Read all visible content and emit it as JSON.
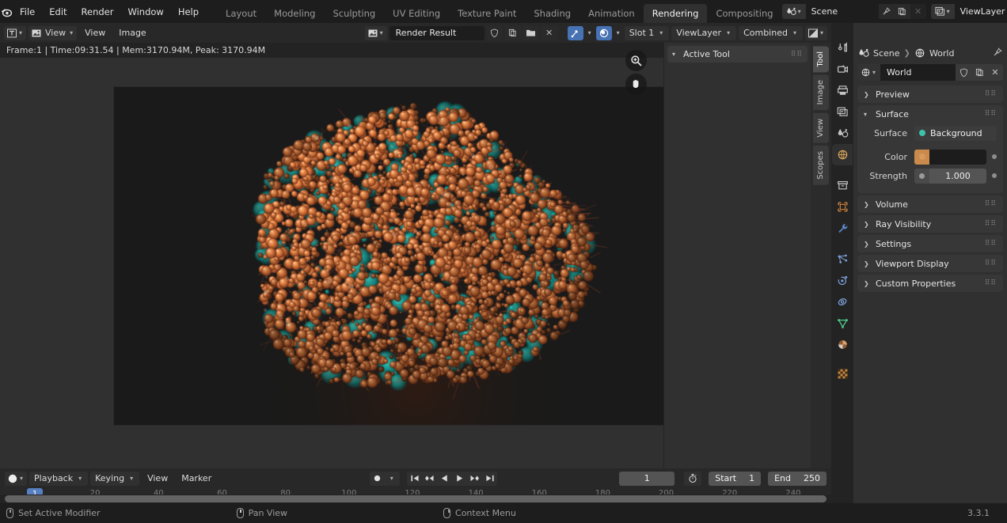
{
  "app": {
    "name": "Blender",
    "version": "3.3.1"
  },
  "topbar": {
    "menus": [
      "File",
      "Edit",
      "Render",
      "Window",
      "Help"
    ],
    "workspaces": [
      {
        "label": "Layout",
        "active": false
      },
      {
        "label": "Modeling",
        "active": false
      },
      {
        "label": "Sculpting",
        "active": false
      },
      {
        "label": "UV Editing",
        "active": false
      },
      {
        "label": "Texture Paint",
        "active": false
      },
      {
        "label": "Shading",
        "active": false
      },
      {
        "label": "Animation",
        "active": false
      },
      {
        "label": "Rendering",
        "active": true
      },
      {
        "label": "Compositing",
        "active": false
      }
    ],
    "scene": {
      "name": "Scene",
      "icon": "scene-icon"
    },
    "viewlayer": {
      "name": "ViewLayer",
      "icon": "viewlayer-icon"
    }
  },
  "image_editor": {
    "editor_type_icon": "image-editor-icon",
    "display_mode": "View",
    "menus": [
      "View",
      "Image"
    ],
    "image_datablock": "Render Result",
    "slot": "Slot 1",
    "view_layer": "ViewLayer",
    "pass": "Combined",
    "render_info": "Frame:1 | Time:09:31.54 | Mem:3170.94M, Peak: 3170.94M",
    "gizmos": [
      "zoom-icon",
      "pan-icon"
    ]
  },
  "sidebar": {
    "panels": [
      {
        "label": "Active Tool",
        "open": true
      }
    ],
    "tabs": [
      {
        "label": "Tool",
        "active": true
      },
      {
        "label": "Image",
        "active": false
      },
      {
        "label": "View",
        "active": false
      },
      {
        "label": "Scopes",
        "active": false
      }
    ]
  },
  "properties": {
    "breadcrumb": {
      "scene": "Scene",
      "datablock": "World"
    },
    "id_name": "World",
    "tabs": [
      {
        "name": "tool",
        "active": false
      },
      {
        "name": "render",
        "active": false
      },
      {
        "name": "output",
        "active": false
      },
      {
        "name": "view-layer",
        "active": false
      },
      {
        "name": "scene",
        "active": false
      },
      {
        "name": "world",
        "active": true
      },
      {
        "name": "collection",
        "active": false
      },
      {
        "name": "object",
        "active": false
      },
      {
        "name": "modifier",
        "active": false
      },
      {
        "name": "particles",
        "active": false
      },
      {
        "name": "physics",
        "active": false
      },
      {
        "name": "constraints",
        "active": false
      },
      {
        "name": "data",
        "active": false
      },
      {
        "name": "material",
        "active": false
      },
      {
        "name": "texture",
        "active": false
      }
    ],
    "panels": [
      {
        "label": "Preview",
        "open": false
      },
      {
        "label": "Surface",
        "open": true
      },
      {
        "label": "Volume",
        "open": false
      },
      {
        "label": "Ray Visibility",
        "open": false
      },
      {
        "label": "Settings",
        "open": false
      },
      {
        "label": "Viewport Display",
        "open": false
      },
      {
        "label": "Custom Properties",
        "open": false
      }
    ],
    "surface": {
      "surface_label": "Surface",
      "surface_value": "Background",
      "color_label": "Color",
      "color_value": "#1c1c1c",
      "strength_label": "Strength",
      "strength_value": "1.000"
    }
  },
  "timeline": {
    "editor_icon": "timeline-icon",
    "menus": [
      "Playback",
      "Keying",
      "View",
      "Marker"
    ],
    "current_frame": "1",
    "start_label": "Start",
    "start_value": "1",
    "end_label": "End",
    "end_value": "250",
    "ruler_ticks": [
      "20",
      "40",
      "60",
      "80",
      "100",
      "120",
      "140",
      "160",
      "180",
      "200",
      "220",
      "240"
    ],
    "playhead_label": "1"
  },
  "statusbar": {
    "items": [
      {
        "label": "Set Active Modifier",
        "icon": "mouse-left-icon"
      },
      {
        "label": "Pan View",
        "icon": "mouse-middle-icon"
      },
      {
        "label": "Context Menu",
        "icon": "mouse-right-icon"
      }
    ],
    "version": "3.3.1"
  },
  "render_preview": {
    "description": "particle-cluster-render",
    "sphere_color": "#c0703c",
    "accent_color": "#18a89a",
    "background": "#1a1a1a"
  }
}
